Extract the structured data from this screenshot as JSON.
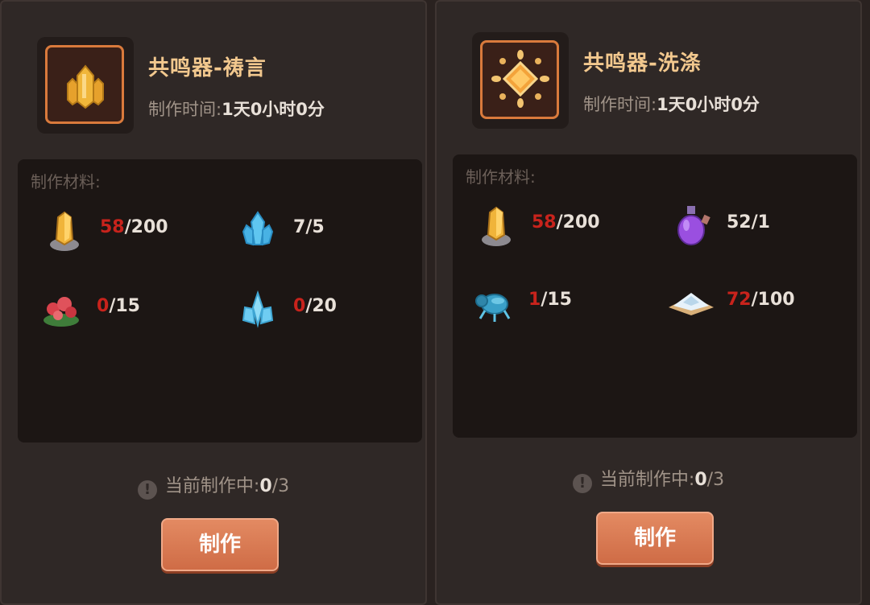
{
  "cards": [
    {
      "name": "共鸣器-祷言",
      "time_label": "制作时间:",
      "time_value": "1天0小时0分",
      "icon": "gold-crystal-icon",
      "materials_label": "制作材料:",
      "materials": [
        {
          "icon": "gold-ore-icon",
          "have": "58",
          "need": "/200",
          "short": true
        },
        {
          "icon": "blue-crystal-icon",
          "have": "7",
          "need": "/5",
          "short": false
        },
        {
          "icon": "red-flower-icon",
          "have": "0",
          "need": "/15",
          "short": true
        },
        {
          "icon": "ice-crystal-icon",
          "have": "0",
          "need": "/20",
          "short": true
        }
      ],
      "status_label": "当前制作中:",
      "status_current": "0",
      "status_max": "/3",
      "button_label": "制作"
    },
    {
      "name": "共鸣器-洗涤",
      "time_label": "制作时间:",
      "time_value": "1天0小时0分",
      "icon": "amber-gem-icon",
      "materials_label": "制作材料:",
      "materials": [
        {
          "icon": "gold-ore-icon",
          "have": "58",
          "need": "/200",
          "short": true
        },
        {
          "icon": "purple-potion-icon",
          "have": "52",
          "need": "/1",
          "short": false
        },
        {
          "icon": "blue-beetle-icon",
          "have": "1",
          "need": "/15",
          "short": true
        },
        {
          "icon": "salt-pile-icon",
          "have": "72",
          "need": "/100",
          "short": true
        }
      ],
      "status_label": "当前制作中:",
      "status_current": "0",
      "status_max": "/3",
      "button_label": "制作"
    }
  ],
  "colors": {
    "title": "#f2c88e",
    "shortage": "#c8231c",
    "button": "#d97550",
    "panel": "#1c1614"
  }
}
